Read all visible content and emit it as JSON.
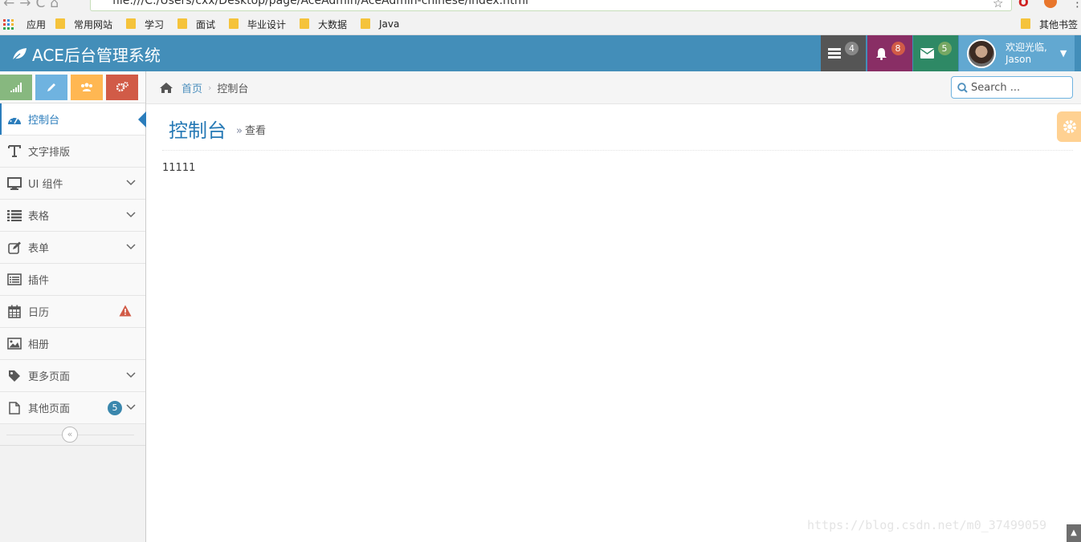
{
  "browser": {
    "url": "file:///C:/Users/cxx/Desktop/page/AceAdmin/AceAdmin-chinese/index.html",
    "bookmarks": [
      "应用",
      "常用网站",
      "学习",
      "面试",
      "毕业设计",
      "大数据",
      "Java"
    ],
    "other_bookmarks": "其他书签"
  },
  "navbar": {
    "brand": "ACE后台管理系统",
    "tasks_count": "4",
    "notifications_count": "8",
    "messages_count": "5",
    "welcome": "欢迎光临,",
    "username": "Jason",
    "colors": {
      "navbar": "#438eb9",
      "tasks": "#555555",
      "notifications": "#892e65",
      "messages": "#2e8965",
      "user": "#62a8d1"
    }
  },
  "sidebar": {
    "shortcut_icons": [
      "signal-icon",
      "pencil-icon",
      "users-icon",
      "cogs-icon"
    ],
    "items": [
      {
        "label": "控制台",
        "icon": "dashboard-icon",
        "active": true
      },
      {
        "label": "文字排版",
        "icon": "text-icon"
      },
      {
        "label": "UI 组件",
        "icon": "desktop-icon",
        "has_submenu": true
      },
      {
        "label": "表格",
        "icon": "list-icon",
        "has_submenu": true
      },
      {
        "label": "表单",
        "icon": "edit-icon",
        "has_submenu": true
      },
      {
        "label": "插件",
        "icon": "list-alt-icon"
      },
      {
        "label": "日历",
        "icon": "calendar-icon",
        "warning": true
      },
      {
        "label": "相册",
        "icon": "picture-icon"
      },
      {
        "label": "更多页面",
        "icon": "tag-icon",
        "has_submenu": true
      },
      {
        "label": "其他页面",
        "icon": "file-icon",
        "has_submenu": true,
        "badge": "5"
      }
    ]
  },
  "breadcrumbs": {
    "home": "首页",
    "current": "控制台"
  },
  "search": {
    "placeholder": "Search ..."
  },
  "page": {
    "title": "控制台",
    "subtitle": "查看",
    "content": "11111"
  },
  "watermark": "https://blog.csdn.net/m0_37499059"
}
